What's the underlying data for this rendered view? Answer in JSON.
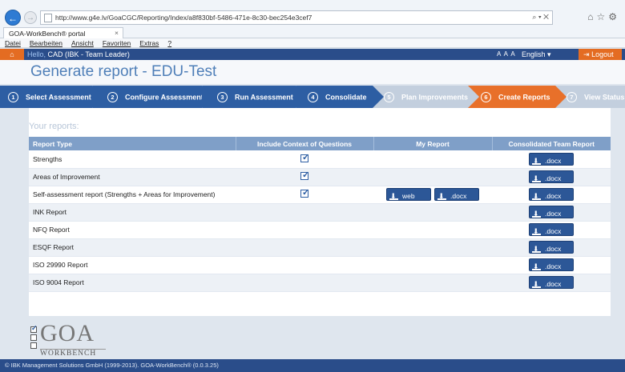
{
  "browser": {
    "url": "http://www.g4e.lv/GoaCGC/Reporting/Index/a8f830bf-5486-471e-8c30-bec254e3cef7",
    "tab_title": "GOA-WorkBench® portal",
    "menu": [
      "Datei",
      "Bearbeiten",
      "Ansicht",
      "Favoriten",
      "Extras",
      "?"
    ]
  },
  "header": {
    "hello_label": "Hello,",
    "user": "CAD (IBK - Team Leader)",
    "font_sizes": "A A A",
    "language": "English ▾",
    "logout": "Logout"
  },
  "page": {
    "title": "Generate report - EDU-Test"
  },
  "steps": [
    {
      "num": "1",
      "label": "Select Assessment"
    },
    {
      "num": "2",
      "label": "Configure Assessment"
    },
    {
      "num": "3",
      "label": "Run Assessment"
    },
    {
      "num": "4",
      "label": "Consolidate"
    },
    {
      "num": "5",
      "label": "Plan Improvements"
    },
    {
      "num": "6",
      "label": "Create Reports"
    },
    {
      "num": "7",
      "label": "View Status"
    }
  ],
  "reports": {
    "section_title": "Your reports:",
    "columns": [
      "Report Type",
      "Include Context of Questions",
      "My Report",
      "Consolidated Team Report"
    ],
    "rows": [
      {
        "name": "Strengths",
        "context": true,
        "my": [],
        "team": ".docx"
      },
      {
        "name": "Areas of Improvement",
        "context": true,
        "my": [],
        "team": ".docx"
      },
      {
        "name": "Self-assessment report (Strengths + Areas for Improvement)",
        "context": true,
        "my": [
          "web",
          ".docx"
        ],
        "team": ".docx"
      },
      {
        "name": "INK Report",
        "context": false,
        "my": [],
        "team": ".docx"
      },
      {
        "name": "NFQ Report",
        "context": false,
        "my": [],
        "team": ".docx"
      },
      {
        "name": "ESQF Report",
        "context": false,
        "my": [],
        "team": ".docx"
      },
      {
        "name": "ISO 29990 Report",
        "context": false,
        "my": [],
        "team": ".docx"
      },
      {
        "name": "ISO 9004 Report",
        "context": false,
        "my": [],
        "team": ".docx"
      }
    ]
  },
  "logo": {
    "word": "GOA",
    "sub": "WORKBENCH"
  },
  "footer": {
    "text": "© IBK Management Solutions GmbH (1999-2013). GOA-WorkBench® (0.0.3.25)"
  },
  "colors": {
    "step_done": "#2d5ea3",
    "step_pending": "#c3cfde",
    "step_active": "#e8702a",
    "accent_orange": "#e46c22",
    "header_blue": "#2a4d8a"
  }
}
